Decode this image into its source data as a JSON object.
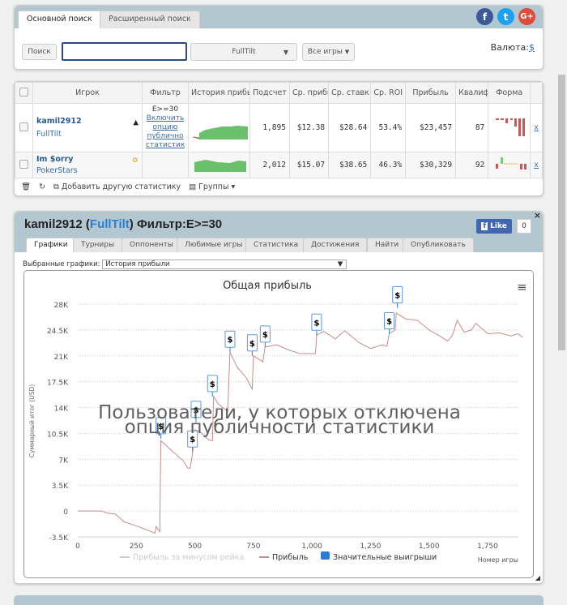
{
  "search": {
    "tabs": [
      "Основной поиск",
      "Расширенный поиск"
    ],
    "search_button": "Поиск",
    "search_value": "",
    "site_select": "FullTilt",
    "games_select": "Все игры",
    "currency_label": "Валюта:",
    "currency_value": "$"
  },
  "social": [
    "facebook-icon",
    "twitter-icon",
    "google-plus-icon"
  ],
  "players_table": {
    "headers": [
      "Игрок",
      "Фильтр",
      "История прибь",
      "Подсчет",
      "Ср. прибь",
      "Ср. ставк:",
      "Ср. ROI",
      "Прибыль",
      "Квалиф",
      "Форма"
    ],
    "rows": [
      {
        "name": "kamil2912",
        "site": "FullTilt",
        "filter": "E>=30",
        "filter_link": "Включить опцию публично статистик",
        "count": "1,895",
        "avg_profit": "$12.38",
        "avg_stake": "$28.64",
        "roi": "53.4%",
        "profit": "$23,457",
        "qual": "87",
        "remove": "x",
        "icon": "shark-icon"
      },
      {
        "name": "Im $orry",
        "site": "PokerStars",
        "filter": "",
        "filter_link": "",
        "count": "2,012",
        "avg_profit": "$15.07",
        "avg_stake": "$38.65",
        "roi": "46.3%",
        "profit": "$30,329",
        "qual": "92",
        "remove": "x",
        "icon": "medal-icon"
      }
    ],
    "footer": {
      "add_stat": "Добавить другую статистику",
      "groups": "Группы"
    }
  },
  "player_panel": {
    "name": "kamil2912",
    "open": "(",
    "site": "FullTilt",
    "close": ")",
    "filter": "Фильтр:E>=30",
    "like": "Like",
    "like_count": "0",
    "tabs": [
      "Графики",
      "Турниры",
      "Оппоненты",
      "Любимые игры",
      "Статистика",
      "Достижения",
      "Найти",
      "Опубликовать"
    ],
    "selected_label": "Выбранные графики:",
    "selected_value": "История прибыли"
  },
  "chart_data": {
    "type": "line",
    "title": "Общая прибыль",
    "xlabel": "Номер игры",
    "ylabel": "Суммарный итог (USD)",
    "xlim": [
      0,
      1900
    ],
    "ylim": [
      -3500,
      28000
    ],
    "xticks": [
      "0",
      "250",
      "500",
      "750",
      "1,000",
      "1,250",
      "1,500",
      "1,750"
    ],
    "yticks": [
      "28K",
      "24.5K",
      "21K",
      "17.5K",
      "14K",
      "10.5K",
      "7K",
      "3.5K",
      "0",
      "-3.5K"
    ],
    "grid": true,
    "legend_position": "bottom",
    "legend": [
      "Прибыль за минусом рейка",
      "Прибыль",
      "Значительные выигрыши"
    ],
    "colors": {
      "profit": "#c98a8a",
      "rake": "#cccccc",
      "wins": "#2e7bd6"
    },
    "series": [
      {
        "name": "Прибыль",
        "points": [
          [
            0,
            0
          ],
          [
            100,
            0
          ],
          [
            130,
            -300
          ],
          [
            160,
            -400
          ],
          [
            200,
            -1500
          ],
          [
            250,
            -2000
          ],
          [
            300,
            -2600
          ],
          [
            330,
            -3000
          ],
          [
            335,
            -2100
          ],
          [
            350,
            -2800
          ],
          [
            355,
            9500
          ],
          [
            400,
            8200
          ],
          [
            450,
            6800
          ],
          [
            470,
            5800
          ],
          [
            480,
            5800
          ],
          [
            490,
            7800
          ],
          [
            500,
            11000
          ],
          [
            520,
            10800
          ],
          [
            560,
            9600
          ],
          [
            575,
            9500
          ],
          [
            580,
            15500
          ],
          [
            600,
            14500
          ],
          [
            640,
            13500
          ],
          [
            650,
            21500
          ],
          [
            680,
            19500
          ],
          [
            720,
            18000
          ],
          [
            745,
            16500
          ],
          [
            750,
            21000
          ],
          [
            790,
            20200
          ],
          [
            800,
            22200
          ],
          [
            850,
            22500
          ],
          [
            900,
            21800
          ],
          [
            950,
            21300
          ],
          [
            1015,
            21300
          ],
          [
            1020,
            23800
          ],
          [
            1050,
            24300
          ],
          [
            1100,
            23300
          ],
          [
            1140,
            24400
          ],
          [
            1200,
            22800
          ],
          [
            1250,
            22000
          ],
          [
            1300,
            22500
          ],
          [
            1320,
            22300
          ],
          [
            1330,
            24000
          ],
          [
            1355,
            24500
          ],
          [
            1360,
            26800
          ],
          [
            1400,
            26000
          ],
          [
            1450,
            25800
          ],
          [
            1500,
            24500
          ],
          [
            1550,
            23600
          ],
          [
            1580,
            23000
          ],
          [
            1600,
            23800
          ],
          [
            1620,
            25800
          ],
          [
            1650,
            24200
          ],
          [
            1680,
            24500
          ],
          [
            1700,
            25400
          ],
          [
            1750,
            24000
          ],
          [
            1800,
            24100
          ],
          [
            1850,
            23700
          ],
          [
            1880,
            24000
          ],
          [
            1900,
            23500
          ]
        ]
      }
    ],
    "big_wins": [
      [
        355,
        9800
      ],
      [
        490,
        8000
      ],
      [
        505,
        12000
      ],
      [
        575,
        15500
      ],
      [
        650,
        21500
      ],
      [
        745,
        21000
      ],
      [
        800,
        22200
      ],
      [
        1020,
        23800
      ],
      [
        1330,
        24000
      ],
      [
        1365,
        27500
      ]
    ],
    "marker_label": "$",
    "overlay": [
      "Пользователи, у которых отключена",
      "опция публичности статистики"
    ]
  }
}
